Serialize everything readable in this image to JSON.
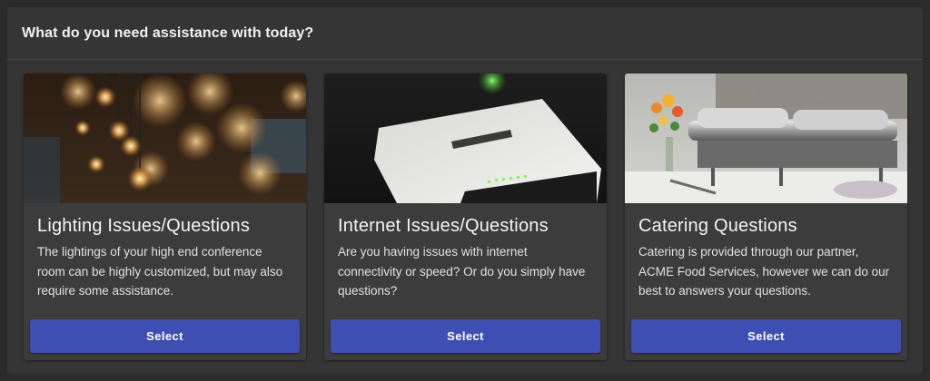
{
  "header": {
    "title": "What do you need assistance with today?"
  },
  "cards": [
    {
      "image_icon": "lightbulbs-photo",
      "title": "Lighting Issues/Questions",
      "description": "The lightings of your high end conference room can be highly customized, but may also require some assistance.",
      "button_label": "Select"
    },
    {
      "image_icon": "router-photo",
      "title": "Internet Issues/Questions",
      "description": "Are you having issues with internet connectivity or speed? Or do you simply have questions?",
      "button_label": "Select"
    },
    {
      "image_icon": "catering-buffet-photo",
      "title": "Catering Questions",
      "description": "Catering is provided through our partner, ACME Food Services, however we can do our best to answers your questions.",
      "button_label": "Select"
    }
  ],
  "colors": {
    "button": "#3d4fb3",
    "card": "#3c3c3c",
    "panel": "#353535",
    "background": "#2b2b2b"
  }
}
